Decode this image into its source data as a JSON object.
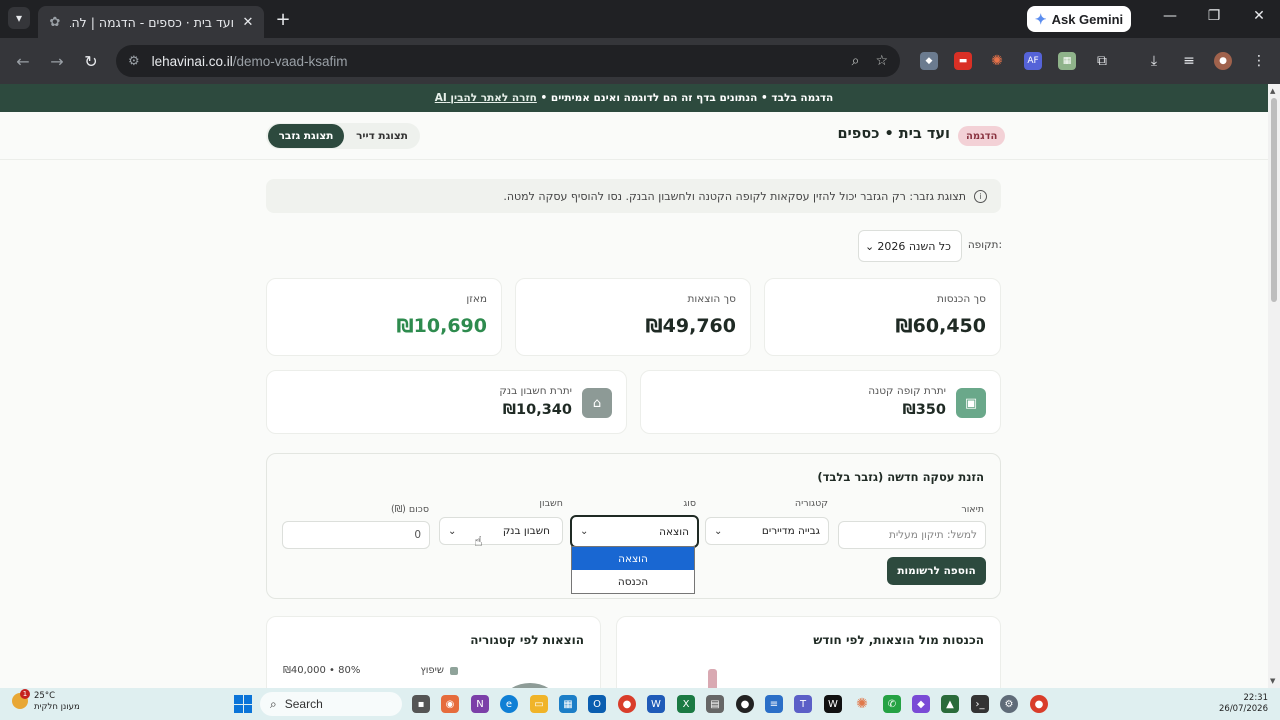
{
  "browser": {
    "tab_title": "ועד בית · כספים - הדגמה | להבין",
    "url_domain": "lehavinai.co.il",
    "url_path": "/demo-vaad-ksafim",
    "gemini_label": "Ask Gemini",
    "extensions": [
      "AF"
    ]
  },
  "banner": {
    "text": "הדגמה בלבד • הנתונים בדף זה הם לדוגמה ואינם אמיתיים • ",
    "link": "חזרה לאתר להבין AI"
  },
  "header": {
    "badge": "הדגמה",
    "title": "ועד בית • כספים",
    "view_treasurer": "תצוגת גזבר",
    "view_tenant": "תצוגת דייר"
  },
  "info": {
    "text": "תצוגת גזבר: רק הגזבר יכול להזין עסקאות לקופה הקטנה ולחשבון הבנק. נסו להוסיף עסקה למטה."
  },
  "period": {
    "label": "תקופה:",
    "value": "כל השנה 2026"
  },
  "summary": {
    "income_label": "סך הכנסות",
    "income_value": "₪60,450",
    "expenses_label": "סך הוצאות",
    "expenses_value": "₪49,760",
    "balance_label": "מאזן",
    "balance_value": "₪10,690"
  },
  "accounts": {
    "petty_label": "יתרת קופה קטנה",
    "petty_value": "₪350",
    "bank_label": "יתרת חשבון בנק",
    "bank_value": "₪10,340"
  },
  "form": {
    "title": "הזנת עסקה חדשה (גזבר בלבד)",
    "desc_label": "תיאור",
    "desc_placeholder": "למשל: תיקון מעלית",
    "category_label": "קטגוריה",
    "category_value": "גבייה מדיירים",
    "type_label": "סוג",
    "type_value": "הוצאה",
    "account_label": "חשבון",
    "account_value": "חשבון בנק",
    "amount_label": "סכום (₪)",
    "amount_value": "0",
    "submit": "הוספה לרשומות",
    "type_options": [
      "הוצאה",
      "הכנסה"
    ]
  },
  "charts": {
    "monthly_title": "הכנסות מול הוצאות, לפי חודש",
    "category_title": "הוצאות לפי קטגוריה",
    "legend_item": "שיפוץ",
    "legend_value": "₪40,000 • 80%"
  },
  "taskbar": {
    "search": "Search",
    "temp": "25°C",
    "weather": "מעונן חלקית",
    "time": "22:31",
    "date": "26/07/2026",
    "notif_count": "1"
  },
  "colors": {
    "brand": "#2d4a3e",
    "positive": "#2e8b4e",
    "badge_bg": "#f3d1d6",
    "selected_option": "#1967d2"
  }
}
